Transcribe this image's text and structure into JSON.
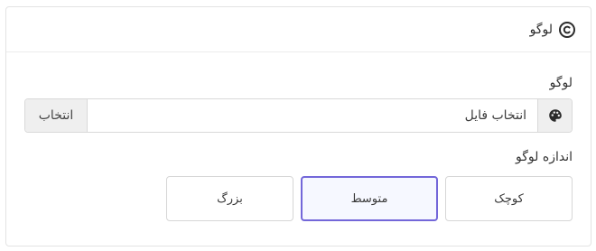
{
  "card": {
    "title": "لوگو",
    "title_icon": "copyright-icon"
  },
  "logo_field": {
    "label": "لوگو",
    "prefix_icon": "palette-icon",
    "value": "انتخاب فایل",
    "choose_button": "انتخاب"
  },
  "logo_size": {
    "label": "اندازه لوگو",
    "options": [
      {
        "label": "کوچک",
        "selected": false
      },
      {
        "label": "متوسط",
        "selected": true
      },
      {
        "label": "بزرگ",
        "selected": false
      }
    ],
    "accent_color": "#7367d9"
  }
}
